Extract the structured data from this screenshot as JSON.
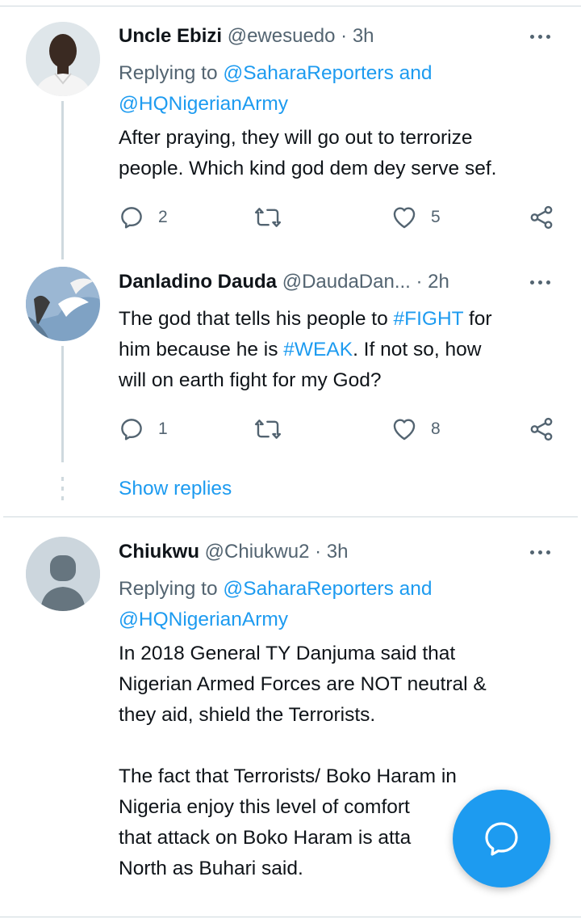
{
  "tweets": [
    {
      "name": "Uncle Ebizi",
      "handle": "@ewesuedo",
      "time": "· 3h",
      "replying_prefix": "Replying to",
      "replying_link1": "@SaharaReporters and",
      "replying_link2": "@HQNigerianArmy",
      "text_line1": "After praying, they will go out to terrorize",
      "text_line2": "people. Which kind god dem dey serve sef.",
      "reply_count": "2",
      "like_count": "5"
    },
    {
      "name": "Danladino Dauda",
      "handle": "@DaudaDan...",
      "time": "· 2h",
      "text": {
        "l1_a": "The god that tells his people to ",
        "l1_tag": "#FIGHT",
        "l1_b": " for",
        "l2_a": "him because he is ",
        "l2_tag": "#WEAK",
        "l2_b": ". If not so, how",
        "l3": "will on earth fight for my God?"
      },
      "reply_count": "1",
      "like_count": "8"
    },
    {
      "name": "Chiukwu",
      "handle": "@Chiukwu2",
      "time": "· 3h",
      "replying_prefix": "Replying to",
      "replying_link1": "@SaharaReporters and",
      "replying_link2": "@HQNigerianArmy",
      "p1_l1": "In 2018 General TY Danjuma said that",
      "p1_l2": "Nigerian Armed Forces are NOT neutral &",
      "p1_l3": "they aid, shield the Terrorists.",
      "p2_l1": "The fact that Terrorists/ Boko Haram in",
      "p2_l2": "Nigeria enjoy this level of comfort",
      "p2_l3": "that attack on Boko Haram is atta",
      "p2_l4": "North as Buhari said."
    }
  ],
  "show_replies": "Show replies",
  "icons": {
    "reply": "reply-icon",
    "retweet": "retweet-icon",
    "like": "heart-icon",
    "share": "share-icon",
    "more": "more-icon",
    "compose": "compose-reply-icon"
  },
  "colors": {
    "accent": "#1d9bf0",
    "muted": "#536471",
    "text": "#0f1419",
    "divider": "#cfd9de"
  }
}
